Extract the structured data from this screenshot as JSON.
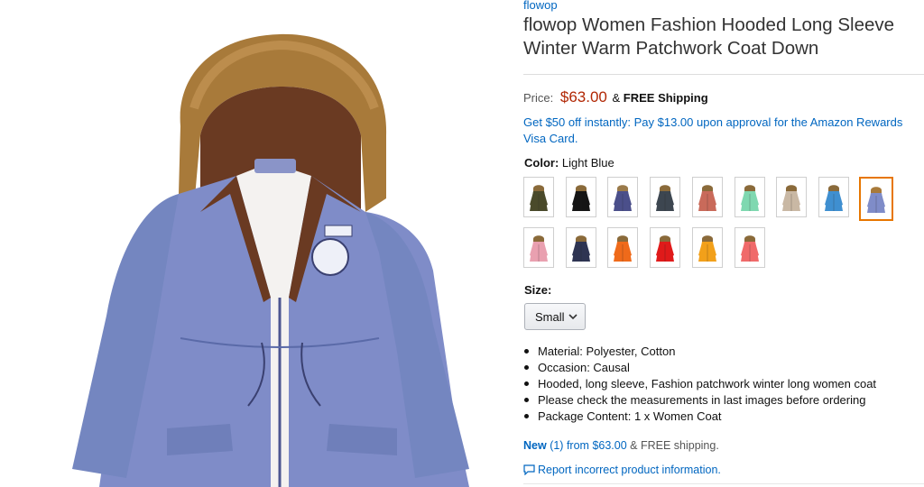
{
  "brand": "flowop",
  "title": "flowop Women Fashion Hooded Long Sleeve Winter Warm Patchwork Coat Down",
  "price": {
    "label": "Price:",
    "amount": "$63.00",
    "amp": "&",
    "shipping": "FREE Shipping"
  },
  "promo": "Get $50 off instantly: Pay $13.00 upon approval for the Amazon Rewards Visa Card.",
  "color": {
    "label": "Color:",
    "selected": "Light Blue",
    "swatches": [
      {
        "color": "#4a4a2a",
        "fur": "#8a6a3a",
        "selected": false
      },
      {
        "color": "#151515",
        "fur": "#8a6a3a",
        "selected": false
      },
      {
        "color": "#4b4f8a",
        "fur": "#9a7a4a",
        "selected": false
      },
      {
        "color": "#3d4650",
        "fur": "#8a6a3a",
        "selected": false
      },
      {
        "color": "#c96a5a",
        "fur": "#8a6a3a",
        "selected": false
      },
      {
        "color": "#7fd8b0",
        "fur": "#8a6a3a",
        "selected": false
      },
      {
        "color": "#c9b8a4",
        "fur": "#8a6a3a",
        "selected": false
      },
      {
        "color": "#3f8fd0",
        "fur": "#8a6a3a",
        "selected": false
      },
      {
        "color": "#7f8cc8",
        "fur": "#a87a3a",
        "selected": true
      },
      {
        "color": "#e9a0b0",
        "fur": "#8a6a3a",
        "selected": false
      },
      {
        "color": "#2e3452",
        "fur": "#8a6a3a",
        "selected": false
      },
      {
        "color": "#ef6a1a",
        "fur": "#8a6a3a",
        "selected": false
      },
      {
        "color": "#e01a1a",
        "fur": "#8a6a3a",
        "selected": false
      },
      {
        "color": "#f2a01a",
        "fur": "#8a6a3a",
        "selected": false
      },
      {
        "color": "#f06a6a",
        "fur": "#8a6a3a",
        "selected": false
      }
    ]
  },
  "size": {
    "label": "Size:",
    "selected": "Small"
  },
  "bullets": [
    "Material: Polyester, Cotton",
    "Occasion: Causal",
    "Hooded, long sleeve, Fashion patchwork winter long women coat",
    "Please check the measurements in last images before ordering",
    "Package Content: 1 x Women Coat"
  ],
  "offers": {
    "new_label": "New",
    "count": "(1)",
    "from": "from",
    "price": "$63.00",
    "rest": "& FREE shipping."
  },
  "report_link": "Report incorrect product information.",
  "colors": {
    "link": "#0066c0",
    "price": "#b12704",
    "selected_border": "#e77600",
    "coat": "#7f8cc8",
    "fur": "#a87a3a"
  }
}
